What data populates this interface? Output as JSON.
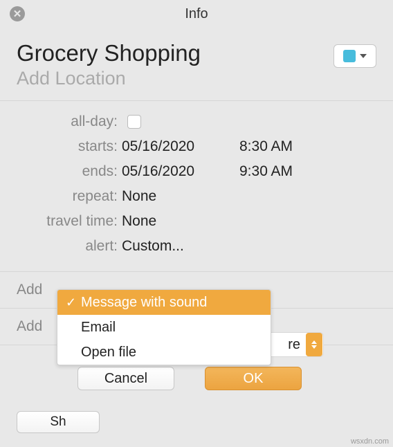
{
  "window": {
    "title": "Info"
  },
  "event": {
    "title": "Grocery Shopping",
    "location_placeholder": "Add Location",
    "color": "#47bcdc"
  },
  "form": {
    "allday_label": "all-day:",
    "allday_checked": false,
    "starts_label": "starts:",
    "starts_date": "05/16/2020",
    "starts_time": "8:30 AM",
    "ends_label": "ends:",
    "ends_date": "05/16/2020",
    "ends_time": "9:30 AM",
    "repeat_label": "repeat:",
    "repeat_value": "None",
    "travel_label": "travel time:",
    "travel_value": "None",
    "alert_label": "alert:",
    "alert_value": "Custom..."
  },
  "sections": {
    "add_notes_prefix": "Add",
    "add_attachments_prefix": "Add"
  },
  "popup": {
    "items": [
      {
        "label": "Message with sound",
        "selected": true
      },
      {
        "label": "Email",
        "selected": false
      },
      {
        "label": "Open file",
        "selected": false
      }
    ]
  },
  "more_button": {
    "label": "re"
  },
  "dialog": {
    "cancel": "Cancel",
    "ok": "OK"
  },
  "show_button": {
    "label": "Sh"
  },
  "watermark": "wsxdn.com"
}
